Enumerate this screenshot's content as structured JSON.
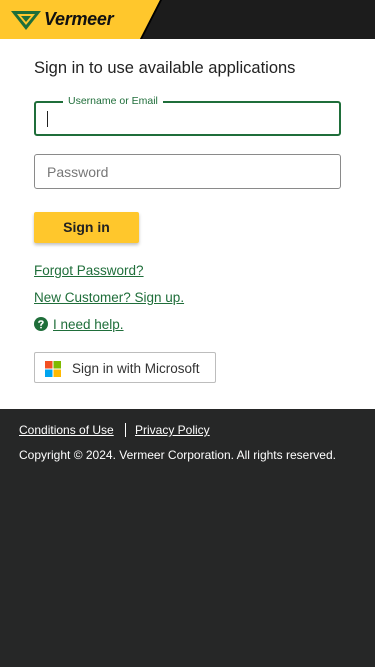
{
  "header": {
    "brand_name": "Vermeer",
    "colors": {
      "yellow": "#ffc72c",
      "dark": "#1c1c1c"
    },
    "logo_icon": "vermeer-v-logo-icon"
  },
  "login": {
    "heading": "Sign in to use available applications",
    "username": {
      "label": "Username or Email",
      "value": ""
    },
    "password": {
      "placeholder": "Password",
      "value": ""
    },
    "signin_label": "Sign in",
    "forgot_label": "Forgot Password?",
    "new_customer_label": "New Customer? Sign up.",
    "help_label": " I need help.",
    "help_icon": "question-circle-icon",
    "microsoft_label": "Sign in with Microsoft",
    "microsoft_icon": "microsoft-logo-icon",
    "accent_color": "#1f6e3a"
  },
  "footer": {
    "conditions_label": "Conditions of Use",
    "privacy_label": "Privacy Policy",
    "copyright": "Copyright © 2024. Vermeer Corporation. All rights reserved.",
    "background": "#262727"
  }
}
